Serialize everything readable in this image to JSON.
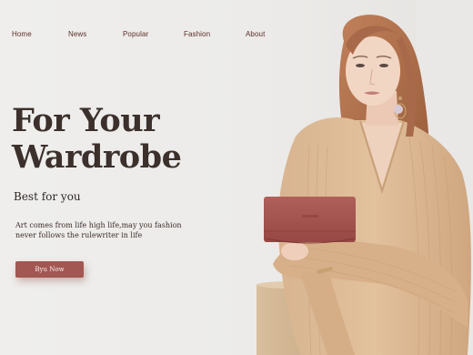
{
  "nav": {
    "items": [
      {
        "label": "Home"
      },
      {
        "label": "News"
      },
      {
        "label": "Popular"
      },
      {
        "label": "Fashion"
      },
      {
        "label": "About"
      }
    ]
  },
  "hero": {
    "headline_line1": "For Your",
    "headline_line2": "Wardrobe",
    "subtitle": "Best for you",
    "description_line1": "Art comes from life high life,may you fashion",
    "description_line2": "never follows the rulewriter in life",
    "cta_label": "Byu Now"
  },
  "colors": {
    "background": "#efeeec",
    "nav_text": "#5a2e2a",
    "headline": "#3b302b",
    "accent": "#a25752",
    "sweater": "#d9b38d",
    "wallet": "#a5524e"
  },
  "images": {
    "hero_photo": "woman-in-beige-sweater-holding-red-wallet"
  }
}
